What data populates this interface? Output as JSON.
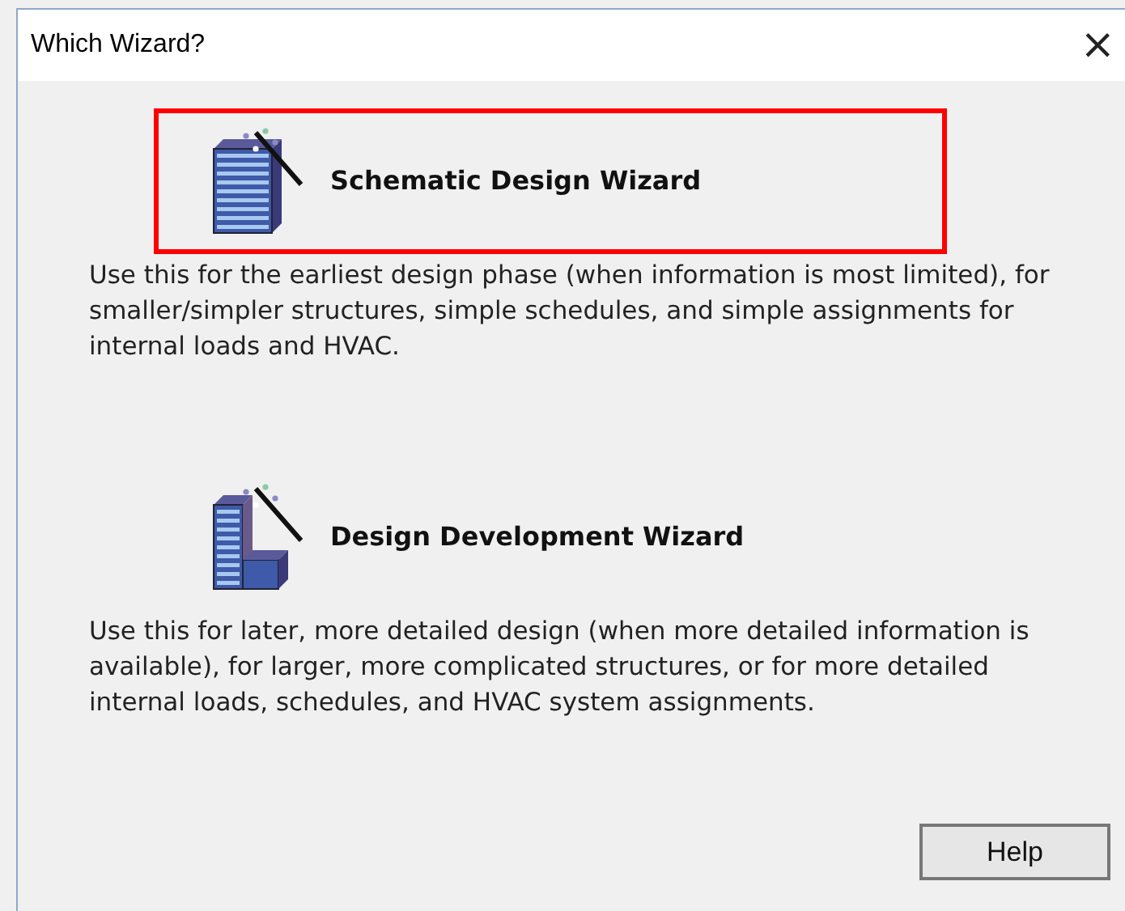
{
  "window": {
    "title": "Which Wizard?",
    "close": "×"
  },
  "options": [
    {
      "label": "Schematic Design Wizard",
      "kind": "schematic",
      "selected": true,
      "description": "Use this for the earliest design phase (when information is most limited), for smaller/simpler structures, simple schedules, and simple assignments for internal loads and HVAC."
    },
    {
      "label": "Design Development Wizard",
      "kind": "development",
      "selected": false,
      "description": "Use this for later, more detailed design (when more detailed information is available), for larger, more complicated structures, or for more detailed internal loads, schedules, and HVAC system assignments."
    }
  ],
  "buttons": [
    "Help"
  ]
}
